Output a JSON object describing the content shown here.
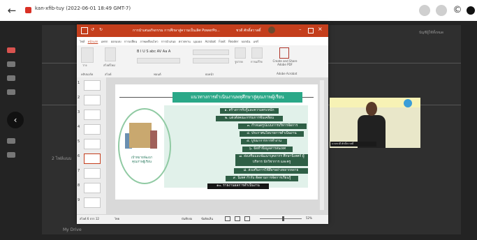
{
  "meeting": {
    "title": "kan-xfib-tuy (2022-06-01 18:49 GMT-7)",
    "rec_color": "#d93025"
  },
  "ppt": {
    "window_title": "การนำเสนอกิจกรรม การศึกษาสู่ความเป็นเลิศ  PowerPo...",
    "user": "ชวดี ศักดิ์สวาสดิ์",
    "menus": [
      "ไฟล์",
      "หน้าแรก",
      "แทรก",
      "ออกแบบ",
      "การเปลี่ยน",
      "ภาพเคลื่อนไหว",
      "การนำเสนอ",
      "ตรวจทาน",
      "มุมมอง",
      "Acrobat",
      "Foxit Reader",
      "บอกฉัน",
      "แชร์"
    ],
    "ribbon_groups": [
      "คลิปบอร์ด",
      "สไลด์",
      "ฟอนต์",
      "ย่อหน้า",
      "Adobe Acrobat"
    ],
    "ribbon_buttons": {
      "paste": "วาง",
      "new_slide": "สไลด์ใหม่",
      "drawing": "รูปวาด",
      "edit": "การแก้ไข",
      "create_pdf": "Create and Share Adobe PDF"
    },
    "statusbar": {
      "slide_info": "สไลด์ 6 จาก 12",
      "lang": "ไทย",
      "notes": "บันทึกย่อ",
      "comments": "ข้อคิดเห็น",
      "zoom": "52%"
    },
    "thumb_numbers": [
      "1",
      "2",
      "3",
      "4",
      "5",
      "6",
      "7",
      "8",
      "9"
    ],
    "active_thumb": 5
  },
  "slide": {
    "heading": "แนวทางการดำเนินงานพหุศึกษาสู่คุณภาพผู้เรียน",
    "left_label": "เป้าหมายพัฒนาคุณภาพผู้เรียน",
    "items": [
      "๑. สร้างการรับรู้และความตระหนัก",
      "๒. แต่งตั้งคณะกรรมการขับเคลื่อน",
      "๓. กำหนดรูปแบบการบริหารจัดการ",
      "๔. ประกาศนโยบายการดำเนินงาน",
      "๕. บูรณาการการทำงาน",
      "๖. จัดทำข้อมูลสารสนเทศ",
      "๗. ส่งเสริมและพัฒนาบุคลากร ศึกษานิเทศก์ ผู้บริหาร นักวิชาการ และครู",
      "๘. ส่งเสริมการใช้สื่อฯอย่างหลากหลาย",
      "๙. นิเทศ กำกับ ติดตามการจัดการเรียนรู้",
      "๑๐. รายงานผลการดำเนินงาน"
    ],
    "accent": "#2aa888",
    "pill_color": "#2f5f46"
  },
  "background": {
    "label_a": "2 ไฟล์แนบ",
    "label_b": "My Drive",
    "label_c": "บัญชีผู้ใช้ทั้งหมด"
  },
  "webcam": {
    "name_tag": "นายชวดี ศักดิ์สวาสดิ์",
    "bg_color": "#e9e7c9"
  }
}
